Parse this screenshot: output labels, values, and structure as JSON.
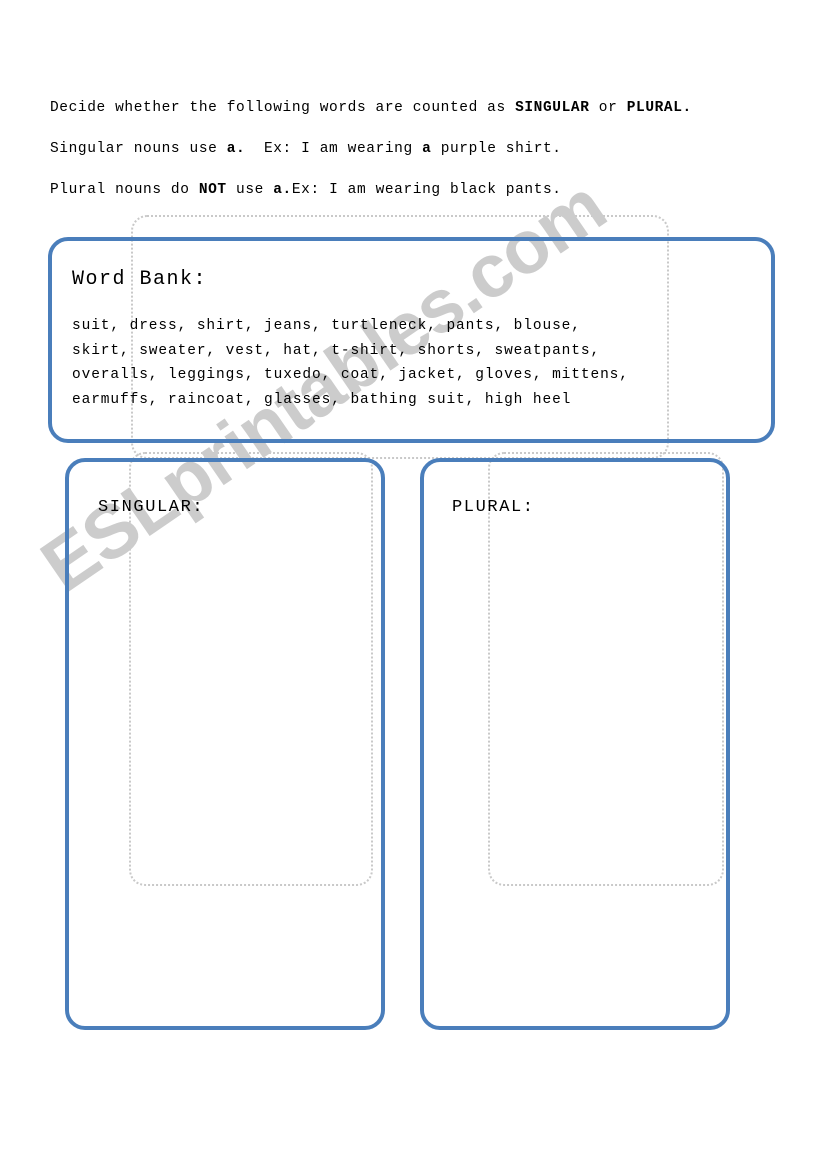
{
  "document": {
    "type": "worksheet",
    "background_color": "#ffffff",
    "accent_color": "#4a7ebb",
    "watermark_color": "#cccccc"
  },
  "instructions": {
    "line1": {
      "part1": "Decide whether the following words are counted as ",
      "bold1": "SINGULAR",
      "part2": " or ",
      "bold2": "PLURAL."
    },
    "line2": {
      "part1": "Singular nouns use ",
      "bold1": "a.",
      "part2": "  Ex: I am wearing ",
      "bold2": "a",
      "part3": " purple shirt."
    },
    "line3": {
      "part1": "Plural nouns do ",
      "bold1": "NOT",
      "part2": " use ",
      "bold2": "a.",
      "part3": "Ex: I am wearing black pants."
    }
  },
  "word_bank": {
    "title": "Word Bank:",
    "lines": [
      "suit, dress, shirt, jeans, turtleneck, pants, blouse,",
      "skirt, sweater, vest, hat, t-shirt, shorts, sweatpants,",
      "overalls, leggings, tuxedo, coat, jacket, gloves, mittens,",
      "earmuffs, raincoat, glasses, bathing suit, high heel"
    ],
    "words": [
      "suit",
      "dress",
      "shirt",
      "jeans",
      "turtleneck",
      "pants",
      "blouse",
      "skirt",
      "sweater",
      "vest",
      "hat",
      "t-shirt",
      "shorts",
      "sweatpants",
      "overalls",
      "leggings",
      "tuxedo",
      "coat",
      "jacket",
      "gloves",
      "mittens",
      "earmuffs",
      "raincoat",
      "glasses",
      "bathing suit",
      "high heel"
    ]
  },
  "answer_areas": {
    "singular": {
      "heading": "SINGULAR:",
      "content": ""
    },
    "plural": {
      "heading": "PLURAL:",
      "content": ""
    }
  },
  "watermark": {
    "text": "ESLprintables.com"
  }
}
